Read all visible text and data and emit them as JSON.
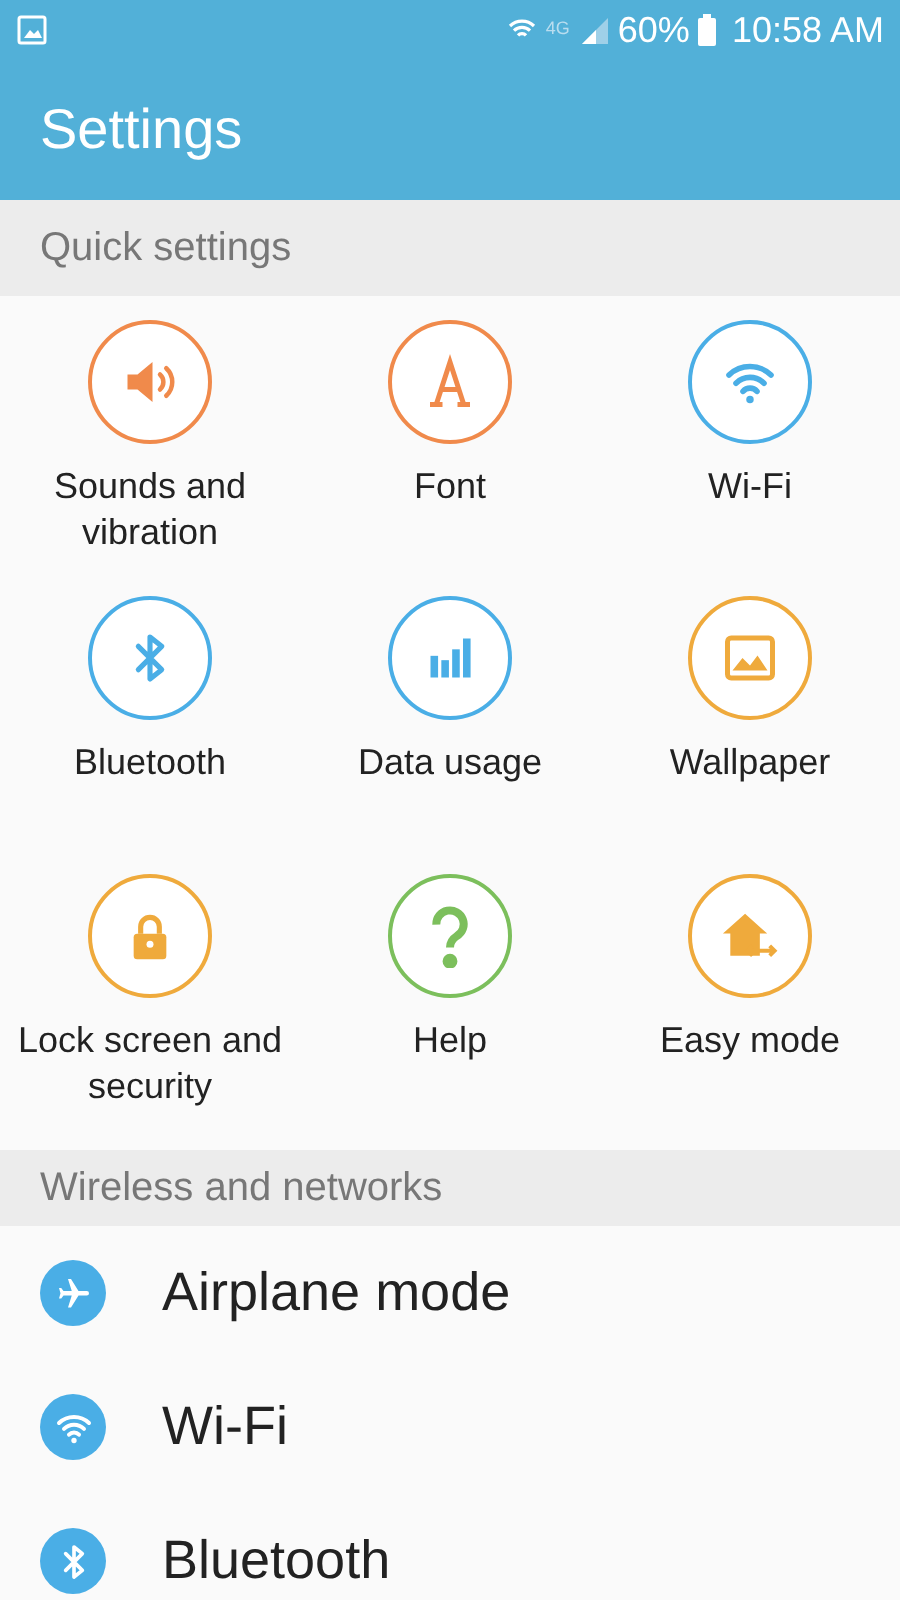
{
  "status_bar": {
    "network": "4G",
    "battery": "60%",
    "time": "10:58 AM"
  },
  "header": {
    "title": "Settings"
  },
  "quick_settings": {
    "heading": "Quick settings",
    "items": [
      {
        "label": "Sounds and vibration",
        "color": "#f08a4b"
      },
      {
        "label": "Font",
        "color": "#f08a4b"
      },
      {
        "label": "Wi-Fi",
        "color": "#4aaee6"
      },
      {
        "label": "Bluetooth",
        "color": "#4aaee6"
      },
      {
        "label": "Data usage",
        "color": "#4aaee6"
      },
      {
        "label": "Wallpaper",
        "color": "#efaa3c"
      },
      {
        "label": "Lock screen and security",
        "color": "#efaa3c"
      },
      {
        "label": "Help",
        "color": "#7cbf5c"
      },
      {
        "label": "Easy mode",
        "color": "#efaa3c"
      }
    ]
  },
  "wireless": {
    "heading": "Wireless and networks",
    "items": [
      {
        "label": "Airplane mode"
      },
      {
        "label": "Wi-Fi"
      },
      {
        "label": "Bluetooth"
      }
    ]
  }
}
